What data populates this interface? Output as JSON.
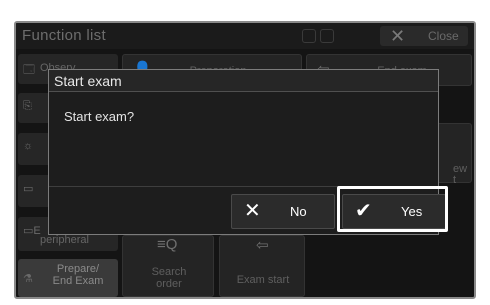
{
  "window": {
    "title": "Function list",
    "close_label": "Close",
    "close_glyph": "✕"
  },
  "sidebar": {
    "items": [
      {
        "label": "Observ.",
        "icon": "🗔"
      },
      {
        "label": "",
        "icon": "⎘"
      },
      {
        "label": "",
        "icon": "☼"
      },
      {
        "label": "",
        "icon": "▭"
      },
      {
        "label": "peripheral",
        "icon": "▭E"
      },
      {
        "label": "Prepare/ End Exam",
        "icon": "⚗"
      }
    ]
  },
  "tiles": {
    "preparation": "Preparation",
    "end_exam": "End exam",
    "search_order": "Search order",
    "exam_start": "Exam start",
    "partial_right": "ew t",
    "preparation_icon": "👤",
    "end_exam_icon": "⇦",
    "search_icon": "≡Q",
    "exam_start_icon": "⇦"
  },
  "dialog": {
    "title": "Start exam",
    "message": "Start exam?",
    "no_label": "No",
    "yes_label": "Yes",
    "no_glyph": "✕",
    "yes_glyph": "✔"
  }
}
